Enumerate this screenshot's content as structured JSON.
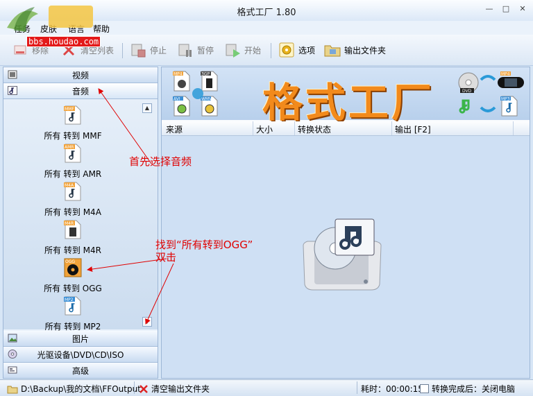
{
  "window": {
    "title": "格式工厂 1.80",
    "watermark_url": "bbs.houdao.com"
  },
  "menu": [
    "任务",
    "皮肤",
    "语言",
    "帮助"
  ],
  "toolbar": {
    "remove": "移除",
    "clear_list": "清空列表",
    "stop": "停止",
    "pause": "暂停",
    "start": "开始",
    "options": "选项",
    "output_folder": "输出文件夹"
  },
  "sidebar": {
    "categories": {
      "video": "视频",
      "audio": "音频",
      "picture": "图片",
      "rom": "光驱设备\\DVD\\CD\\ISO",
      "advanced": "高级"
    },
    "audio_formats": [
      {
        "badge": "MMF",
        "label": "所有 转到 MMF"
      },
      {
        "badge": "AMR",
        "label": "所有 转到 AMR"
      },
      {
        "badge": "M4A",
        "label": "所有 转到 M4A"
      },
      {
        "badge": "M4R",
        "label": "所有 转到 M4R"
      },
      {
        "badge": "OGG",
        "label": "所有 转到 OGG"
      },
      {
        "badge": "MP2",
        "label": "所有 转到 MP2"
      }
    ]
  },
  "banner": {
    "title": "格式工厂",
    "icons_left": [
      "MP4",
      "3GP",
      "AVI",
      "WMV"
    ],
    "icons_right": [
      "DVD",
      "MP4",
      "MP3"
    ]
  },
  "table": {
    "columns": [
      "来源",
      "大小",
      "转换状态",
      "输出 [F2]"
    ]
  },
  "statusbar": {
    "output_path": "D:\\Backup\\我的文档\\FFOutput",
    "clear_output": "清空输出文件夹",
    "elapsed": "耗时：00:00:15",
    "after_convert": "转换完成后：关闭电脑"
  },
  "annotations": {
    "step1": "首先选择音频",
    "step2_line1": "找到“所有转到OGG”",
    "step2_line2": "双击"
  },
  "colors": {
    "annotation": "#e00000",
    "banner_title": "#f28a1c",
    "watermark_bg": "#e31a1a"
  }
}
